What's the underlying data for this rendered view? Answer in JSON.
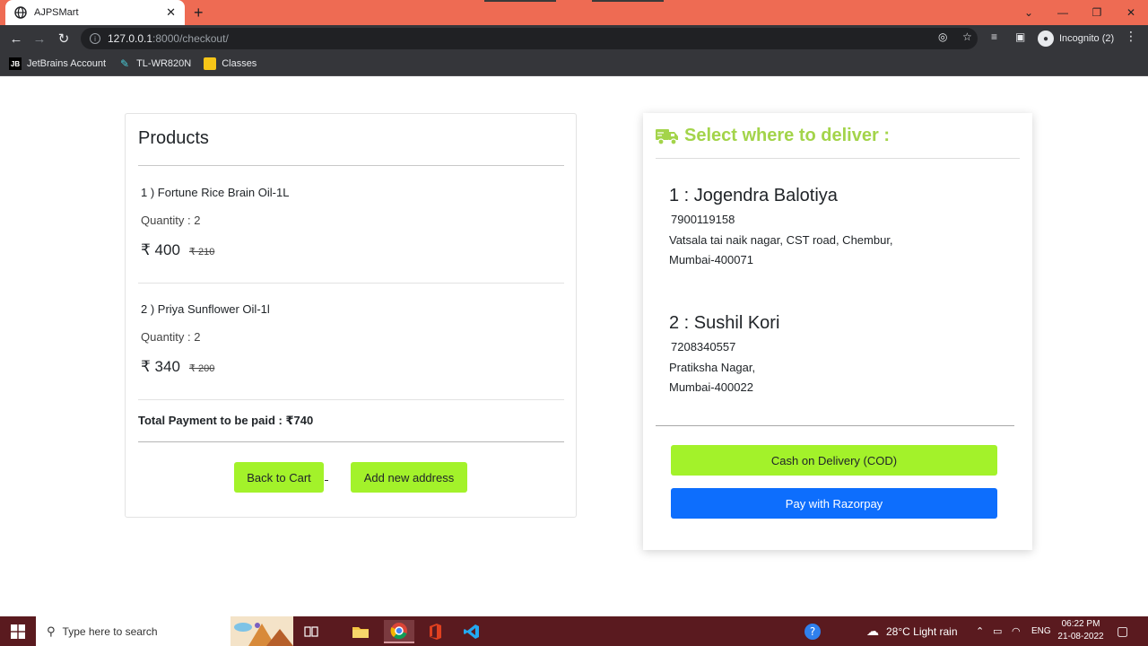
{
  "browser": {
    "tab_title": "AJPSMart",
    "url_host": "127.0.0.1",
    "url_rest": ":8000/checkout/",
    "profile_label": "Incognito (2)",
    "bookmarks": [
      {
        "label": "JetBrains Account"
      },
      {
        "label": "TL-WR820N"
      },
      {
        "label": "Classes"
      }
    ]
  },
  "products": {
    "title": "Products",
    "items": [
      {
        "name": "1 ) Fortune Rice Brain Oil-1L",
        "quantity": "Quantity : 2",
        "price": "₹ 400",
        "old_price": "₹ 210"
      },
      {
        "name": "2 ) Priya Sunflower Oil-1l",
        "quantity": "Quantity : 2",
        "price": "₹ 340",
        "old_price": "₹ 200"
      }
    ],
    "total": "Total Payment to be paid : ₹740",
    "back_button": "Back to Cart",
    "add_address_button": "Add new address"
  },
  "delivery": {
    "title": "Select where to deliver :",
    "title_color": "#a3d44a",
    "addresses": [
      {
        "name": "1 : Jogendra Balotiya",
        "phone": "7900119158",
        "line1": "Vatsala tai naik nagar, CST road, Chembur,",
        "line2": "Mumbai-400071"
      },
      {
        "name": "2 : Sushil Kori",
        "phone": "7208340557",
        "line1": "Pratiksha Nagar,",
        "line2": "Mumbai-400022"
      }
    ],
    "cod_button": "Cash on Delivery (COD)",
    "razorpay_button": "Pay with Razorpay"
  },
  "colors": {
    "accent_green": "#a3f22a",
    "razorpay_blue": "#0d6efd",
    "tab_bar": "#ee6b53",
    "taskbar": "#5a1a1f"
  },
  "taskbar": {
    "search_placeholder": "Type here to search",
    "weather": "28°C  Light rain",
    "language": "ENG",
    "time": "06:22 PM",
    "date": "21-08-2022"
  }
}
